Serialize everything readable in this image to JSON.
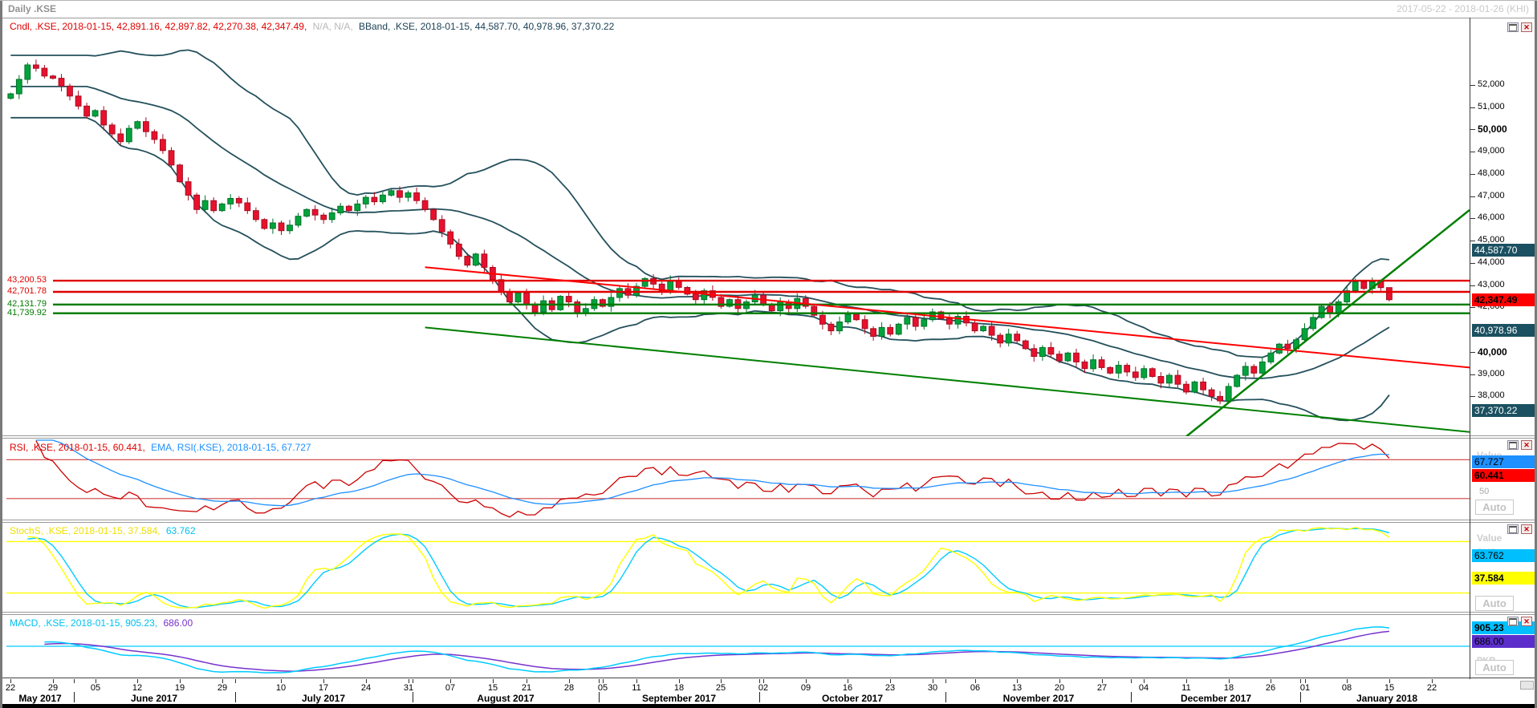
{
  "window": {
    "title": "Daily .KSE",
    "range": "2017-05-22 - 2018-01-26 (KHI)"
  },
  "icons": {
    "close": "✕"
  },
  "colors": {
    "up": "#00a43b",
    "up_border": "#00712a",
    "down": "#e8112d",
    "down_border": "#a50d21",
    "bband": "#24505c",
    "sr_red": "#e00000",
    "sr_green": "#007a00",
    "trend_red": "#ff0000",
    "trend_green": "#008000",
    "rsi": "#cc0000",
    "rsi_level": "#d04040",
    "rsi_ema": "#1e90ff",
    "stoch_k": "#ffff00",
    "stoch_d": "#00ccff",
    "stoch_level": "#ffff00",
    "macd": "#00ccff",
    "macd_signal": "#7733cc",
    "macd_zero": "#00ccff",
    "label_teal": "#1b5060",
    "label_red": "#ff0000",
    "label_blue": "#1e90ff",
    "label_cyan": "#00bfff",
    "label_yellow": "#ffff00",
    "label_purple": "#5b2ecc"
  },
  "main_panel": {
    "legend": {
      "candle": "Cndl, .KSE, 2018-01-15, 42,891.16, 42,897.82, 42,270.38, 42,347.49,",
      "na": "N/A, N/A,",
      "bband": "BBand, .KSE, 2018-01-15, 44,587.70, 40,978.96, 37,370.22"
    },
    "y_ticks": [
      {
        "label": "52,000",
        "value": 52000,
        "bold": false
      },
      {
        "label": "51,000",
        "value": 51000,
        "bold": false
      },
      {
        "label": "50,000",
        "value": 50000,
        "bold": true
      },
      {
        "label": "49,000",
        "value": 49000,
        "bold": false
      },
      {
        "label": "48,000",
        "value": 48000,
        "bold": false
      },
      {
        "label": "47,000",
        "value": 47000,
        "bold": false
      },
      {
        "label": "46,000",
        "value": 46000,
        "bold": false
      },
      {
        "label": "45,000",
        "value": 45000,
        "bold": false
      },
      {
        "label": "44,000",
        "value": 44000,
        "bold": false
      },
      {
        "label": "43,000",
        "value": 43000,
        "bold": false
      },
      {
        "label": "42,000",
        "value": 42000,
        "bold": false
      },
      {
        "label": "40,000",
        "value": 40000,
        "bold": true
      },
      {
        "label": "39,000",
        "value": 39000,
        "bold": false
      },
      {
        "label": "38,000",
        "value": 38000,
        "bold": false
      }
    ],
    "value_labels": [
      {
        "label": "44,587.70",
        "value": 44587.7,
        "style": "teal",
        "bold": false
      },
      {
        "label": "42,347.49",
        "value": 42347.49,
        "style": "red",
        "bold": true
      },
      {
        "label": "40,978.96",
        "value": 40978.96,
        "style": "teal",
        "bold": false
      },
      {
        "label": "37,370.22",
        "value": 37370.22,
        "style": "teal",
        "bold": false
      }
    ],
    "price_lines": [
      {
        "label": "43,200.53",
        "value": 43200.53,
        "color": "red"
      },
      {
        "label": "42,701.78",
        "value": 42701.78,
        "color": "red"
      },
      {
        "label": "42,131.79",
        "value": 42131.79,
        "color": "green"
      },
      {
        "label": "41,739.92",
        "value": 41739.92,
        "color": "green"
      }
    ],
    "trendlines": [
      {
        "color": "red",
        "t1": 49,
        "v1": 43810,
        "t2": 172.5,
        "v2": 39300,
        "width": 2
      },
      {
        "color": "green",
        "t1": 49,
        "v1": 41100,
        "t2": 172.5,
        "v2": 36400,
        "width": 2
      },
      {
        "color": "green",
        "t1": 139,
        "v1": 36200,
        "t2": 172.5,
        "v2": 46380,
        "width": 2.5
      }
    ]
  },
  "rsi_panel": {
    "legend_rsi": "RSI, .KSE, 2018-01-15, 60.441,",
    "legend_ema": "EMA, RSI(.KSE), 2018-01-15, 67.727",
    "value_header": "Value",
    "axis_50": "50",
    "auto_label": "Auto",
    "levels": [
      70,
      30
    ],
    "scale_range": [
      10,
      90
    ],
    "labels": [
      {
        "label": "67.727",
        "value": 67.727,
        "style": "blue",
        "bold": false
      },
      {
        "label": "60.441",
        "value": 60.441,
        "style": "red",
        "bold": true
      }
    ]
  },
  "stoch_panel": {
    "legend_main": "StochS, .KSE, 2018-01-15, 37.584,",
    "legend_d": "63.762",
    "value_header": "Value",
    "currency": "PKR",
    "auto_label": "Auto",
    "levels": [
      80,
      20
    ],
    "scale_range": [
      0,
      100
    ],
    "labels": [
      {
        "label": "63.762",
        "value": 63.762,
        "style": "cyan",
        "bold": false
      },
      {
        "label": "37.584",
        "value": 37.584,
        "style": "yellow",
        "bold": true
      }
    ]
  },
  "macd_panel": {
    "legend_main": "MACD, .KSE, 2018-01-15, 905.23,",
    "legend_signal": "686.00",
    "currency": "PKR",
    "auto_label": "Auto",
    "scale_range": [
      -1600,
      1600
    ],
    "labels": [
      {
        "label": "905.23",
        "value": 905.23,
        "style": "cyan",
        "bold": true
      },
      {
        "label": "686.00",
        "value": 686.0,
        "style": "purple",
        "bold": false
      }
    ]
  },
  "chart_data": {
    "type": "candlestick",
    "symbol": ".KSE",
    "interval": "Daily",
    "period_shown": "2017-05-22 - 2018-01-26",
    "first_open": 51400,
    "last_candle": {
      "date": "2018-01-15",
      "open": 42891.16,
      "high": 42897.82,
      "low": 42270.38,
      "close": 42347.49
    },
    "indicators": {
      "bollinger": {
        "upper": 44587.7,
        "middle": 40978.96,
        "lower": 37370.22
      },
      "rsi": {
        "last": 60.441,
        "ema_last": 67.727
      },
      "stochastics": {
        "k_last": 37.584,
        "d_last": 63.762
      },
      "macd": {
        "last": 905.23,
        "signal_last": 686.0
      }
    },
    "months": [
      {
        "label": "May 2017",
        "days": 8,
        "closes": [
          51600,
          52250,
          52900,
          52750,
          52400,
          52300,
          51950,
          51500
        ],
        "ticks": [
          {
            "day": "22",
            "t": 0
          },
          {
            "day": "29",
            "t": 5
          }
        ]
      },
      {
        "label": "June 2017",
        "days": 19,
        "closes": [
          51050,
          50600,
          50850,
          50200,
          49800,
          49450,
          50050,
          50350,
          49900,
          49550,
          49050,
          48400,
          47650,
          47050,
          46400,
          46800,
          46350,
          46650,
          46900
        ],
        "ticks": [
          {
            "day": "05",
            "t": 10
          },
          {
            "day": "12",
            "t": 15
          },
          {
            "day": "19",
            "t": 20
          },
          {
            "day": "29",
            "t": 25
          }
        ]
      },
      {
        "label": "July 2017",
        "days": 21,
        "closes": [
          46700,
          46350,
          45950,
          45550,
          45800,
          45450,
          45700,
          46100,
          46400,
          46150,
          45950,
          46250,
          46550,
          46350,
          46650,
          46950,
          46750,
          47050,
          47250,
          46950,
          47150
        ],
        "ticks": [
          {
            "day": "10",
            "t": 32
          },
          {
            "day": "17",
            "t": 37
          },
          {
            "day": "24",
            "t": 42
          },
          {
            "day": "31",
            "t": 47
          }
        ]
      },
      {
        "label": "August 2017",
        "days": 22,
        "closes": [
          46800,
          46400,
          45950,
          45400,
          44850,
          44300,
          43900,
          44400,
          43800,
          43250,
          42700,
          42250,
          42650,
          42150,
          41800,
          42300,
          41900,
          42500,
          42250,
          41750,
          41950,
          42350
        ],
        "ticks": [
          {
            "day": "07",
            "t": 52
          },
          {
            "day": "15",
            "t": 57
          },
          {
            "day": "21",
            "t": 61
          },
          {
            "day": "28",
            "t": 66
          }
        ]
      },
      {
        "label": "September 2017",
        "days": 19,
        "closes": [
          42050,
          42450,
          42850,
          42550,
          42950,
          43300,
          43050,
          42750,
          43200,
          42900,
          42600,
          42350,
          42750,
          42450,
          42050,
          42350,
          41950,
          42250,
          42550
        ],
        "ticks": [
          {
            "day": "05",
            "t": 70
          },
          {
            "day": "11",
            "t": 74
          },
          {
            "day": "18",
            "t": 79
          },
          {
            "day": "25",
            "t": 84
          }
        ]
      },
      {
        "label": "October 2017",
        "days": 22,
        "closes": [
          42150,
          41850,
          42250,
          41950,
          42400,
          42050,
          41650,
          41250,
          40950,
          41350,
          41700,
          41450,
          41050,
          40700,
          41100,
          40800,
          41250,
          41550,
          41150,
          41450,
          41800,
          41500
        ],
        "ticks": [
          {
            "day": "02",
            "t": 89
          },
          {
            "day": "09",
            "t": 94
          },
          {
            "day": "16",
            "t": 99
          },
          {
            "day": "23",
            "t": 104
          },
          {
            "day": "30",
            "t": 109
          }
        ]
      },
      {
        "label": "November 2017",
        "days": 22,
        "closes": [
          41250,
          41600,
          41300,
          40950,
          41150,
          40750,
          40400,
          40800,
          40500,
          40150,
          39800,
          40200,
          39900,
          39600,
          39950,
          39550,
          39250,
          39650,
          39300,
          39050,
          39400,
          39100
        ],
        "ticks": [
          {
            "day": "06",
            "t": 114
          },
          {
            "day": "13",
            "t": 119
          },
          {
            "day": "20",
            "t": 124
          },
          {
            "day": "27",
            "t": 129
          }
        ]
      },
      {
        "label": "December 2017",
        "days": 20,
        "closes": [
          38850,
          39250,
          38900,
          38600,
          38950,
          38550,
          38200,
          38650,
          38300,
          38000,
          37800,
          38450,
          38950,
          39350,
          39050,
          39550,
          39950,
          40350,
          40150,
          40550
        ],
        "ticks": [
          {
            "day": "04",
            "t": 134
          },
          {
            "day": "11",
            "t": 139
          },
          {
            "day": "18",
            "t": 144
          },
          {
            "day": "26",
            "t": 149
          }
        ]
      },
      {
        "label": "January 2018",
        "days": 11,
        "closes": [
          41050,
          41550,
          42050,
          41750,
          42250,
          42750,
          43150,
          42850,
          43150,
          42891.16,
          42347.49
        ],
        "ticks": [
          {
            "day": "01",
            "t": 153
          },
          {
            "day": "08",
            "t": 158
          },
          {
            "day": "15",
            "t": 163
          },
          {
            "day": "22",
            "t": 168
          }
        ]
      }
    ]
  }
}
